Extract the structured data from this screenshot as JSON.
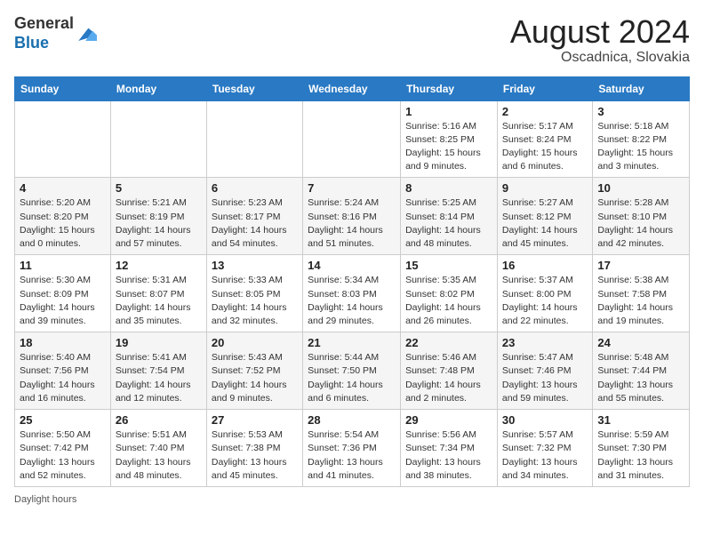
{
  "header": {
    "logo_line1": "General",
    "logo_line2": "Blue",
    "month_year": "August 2024",
    "location": "Oscadnica, Slovakia"
  },
  "footer": {
    "daylight_label": "Daylight hours"
  },
  "days_of_week": [
    "Sunday",
    "Monday",
    "Tuesday",
    "Wednesday",
    "Thursday",
    "Friday",
    "Saturday"
  ],
  "weeks": [
    [
      {
        "day": "",
        "info": ""
      },
      {
        "day": "",
        "info": ""
      },
      {
        "day": "",
        "info": ""
      },
      {
        "day": "",
        "info": ""
      },
      {
        "day": "1",
        "info": "Sunrise: 5:16 AM\nSunset: 8:25 PM\nDaylight: 15 hours and 9 minutes."
      },
      {
        "day": "2",
        "info": "Sunrise: 5:17 AM\nSunset: 8:24 PM\nDaylight: 15 hours and 6 minutes."
      },
      {
        "day": "3",
        "info": "Sunrise: 5:18 AM\nSunset: 8:22 PM\nDaylight: 15 hours and 3 minutes."
      }
    ],
    [
      {
        "day": "4",
        "info": "Sunrise: 5:20 AM\nSunset: 8:20 PM\nDaylight: 15 hours and 0 minutes."
      },
      {
        "day": "5",
        "info": "Sunrise: 5:21 AM\nSunset: 8:19 PM\nDaylight: 14 hours and 57 minutes."
      },
      {
        "day": "6",
        "info": "Sunrise: 5:23 AM\nSunset: 8:17 PM\nDaylight: 14 hours and 54 minutes."
      },
      {
        "day": "7",
        "info": "Sunrise: 5:24 AM\nSunset: 8:16 PM\nDaylight: 14 hours and 51 minutes."
      },
      {
        "day": "8",
        "info": "Sunrise: 5:25 AM\nSunset: 8:14 PM\nDaylight: 14 hours and 48 minutes."
      },
      {
        "day": "9",
        "info": "Sunrise: 5:27 AM\nSunset: 8:12 PM\nDaylight: 14 hours and 45 minutes."
      },
      {
        "day": "10",
        "info": "Sunrise: 5:28 AM\nSunset: 8:10 PM\nDaylight: 14 hours and 42 minutes."
      }
    ],
    [
      {
        "day": "11",
        "info": "Sunrise: 5:30 AM\nSunset: 8:09 PM\nDaylight: 14 hours and 39 minutes."
      },
      {
        "day": "12",
        "info": "Sunrise: 5:31 AM\nSunset: 8:07 PM\nDaylight: 14 hours and 35 minutes."
      },
      {
        "day": "13",
        "info": "Sunrise: 5:33 AM\nSunset: 8:05 PM\nDaylight: 14 hours and 32 minutes."
      },
      {
        "day": "14",
        "info": "Sunrise: 5:34 AM\nSunset: 8:03 PM\nDaylight: 14 hours and 29 minutes."
      },
      {
        "day": "15",
        "info": "Sunrise: 5:35 AM\nSunset: 8:02 PM\nDaylight: 14 hours and 26 minutes."
      },
      {
        "day": "16",
        "info": "Sunrise: 5:37 AM\nSunset: 8:00 PM\nDaylight: 14 hours and 22 minutes."
      },
      {
        "day": "17",
        "info": "Sunrise: 5:38 AM\nSunset: 7:58 PM\nDaylight: 14 hours and 19 minutes."
      }
    ],
    [
      {
        "day": "18",
        "info": "Sunrise: 5:40 AM\nSunset: 7:56 PM\nDaylight: 14 hours and 16 minutes."
      },
      {
        "day": "19",
        "info": "Sunrise: 5:41 AM\nSunset: 7:54 PM\nDaylight: 14 hours and 12 minutes."
      },
      {
        "day": "20",
        "info": "Sunrise: 5:43 AM\nSunset: 7:52 PM\nDaylight: 14 hours and 9 minutes."
      },
      {
        "day": "21",
        "info": "Sunrise: 5:44 AM\nSunset: 7:50 PM\nDaylight: 14 hours and 6 minutes."
      },
      {
        "day": "22",
        "info": "Sunrise: 5:46 AM\nSunset: 7:48 PM\nDaylight: 14 hours and 2 minutes."
      },
      {
        "day": "23",
        "info": "Sunrise: 5:47 AM\nSunset: 7:46 PM\nDaylight: 13 hours and 59 minutes."
      },
      {
        "day": "24",
        "info": "Sunrise: 5:48 AM\nSunset: 7:44 PM\nDaylight: 13 hours and 55 minutes."
      }
    ],
    [
      {
        "day": "25",
        "info": "Sunrise: 5:50 AM\nSunset: 7:42 PM\nDaylight: 13 hours and 52 minutes."
      },
      {
        "day": "26",
        "info": "Sunrise: 5:51 AM\nSunset: 7:40 PM\nDaylight: 13 hours and 48 minutes."
      },
      {
        "day": "27",
        "info": "Sunrise: 5:53 AM\nSunset: 7:38 PM\nDaylight: 13 hours and 45 minutes."
      },
      {
        "day": "28",
        "info": "Sunrise: 5:54 AM\nSunset: 7:36 PM\nDaylight: 13 hours and 41 minutes."
      },
      {
        "day": "29",
        "info": "Sunrise: 5:56 AM\nSunset: 7:34 PM\nDaylight: 13 hours and 38 minutes."
      },
      {
        "day": "30",
        "info": "Sunrise: 5:57 AM\nSunset: 7:32 PM\nDaylight: 13 hours and 34 minutes."
      },
      {
        "day": "31",
        "info": "Sunrise: 5:59 AM\nSunset: 7:30 PM\nDaylight: 13 hours and 31 minutes."
      }
    ]
  ]
}
